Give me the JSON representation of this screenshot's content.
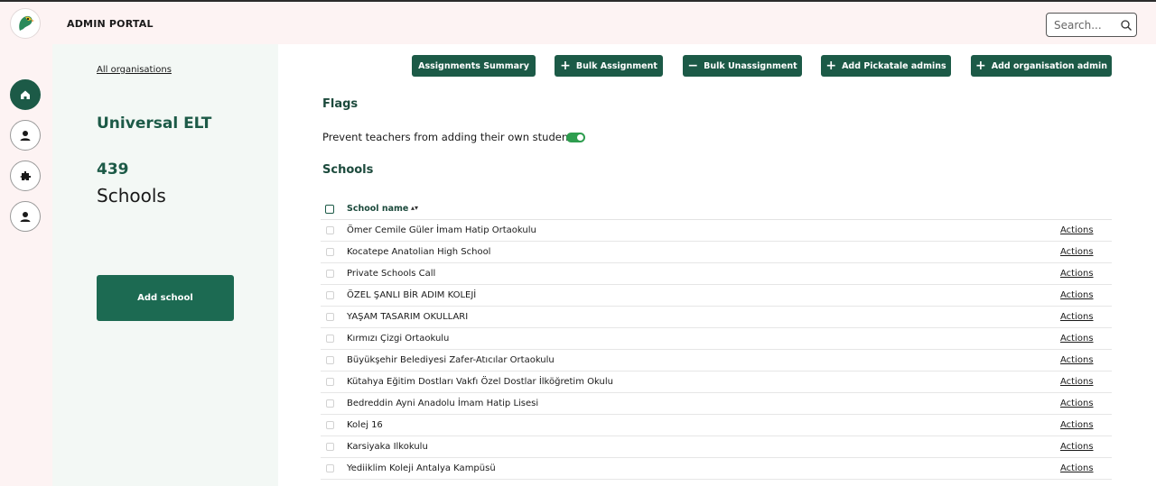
{
  "header": {
    "brand": "ADMIN PORTAL",
    "search_placeholder": "Search..."
  },
  "rail": {
    "items": [
      {
        "icon": "home-icon",
        "active": true
      },
      {
        "icon": "users-icon",
        "active": false
      },
      {
        "icon": "puzzle-icon",
        "active": false
      },
      {
        "icon": "user-icon",
        "active": false
      }
    ]
  },
  "panel": {
    "all_orgs_link": "All organisations",
    "org_name": "Universal ELT",
    "school_count": "439",
    "school_label": "Schools",
    "add_school_label": "Add school"
  },
  "toolbar": {
    "assignments_summary": "Assignments Summary",
    "bulk_assignment": "Bulk Assignment",
    "bulk_unassignment": "Bulk Unassignment",
    "add_pickatale_admins": "Add Pickatale admins",
    "add_org_admin": "Add organisation admin"
  },
  "flags": {
    "heading": "Flags",
    "prevent_teachers_label": "Prevent teachers from adding their own students.",
    "prevent_teachers_enabled": true
  },
  "schools": {
    "heading": "Schools",
    "column_name": "School name",
    "actions_label": "Actions",
    "rows": [
      "Ömer Cemile Güler İmam Hatip Ortaokulu",
      "Kocatepe Anatolian High School",
      "Private Schools Call",
      "ÖZEL ŞANLI BİR ADIM KOLEJİ",
      "YAŞAM TASARIM OKULLARI",
      "Kırmızı Çizgi Ortaokulu",
      "Büyükşehir Belediyesi Zafer-Atıcılar Ortaokulu",
      "Kütahya Eğitim Dostları Vakfı Özel Dostlar İlköğretim Okulu",
      "Bedreddin Ayni Anadolu İmam Hatip Lisesi",
      "Kolej 16",
      "Karsiyaka Ilkokulu",
      "Yediiklim Koleji Antalya Kampüsü"
    ]
  },
  "colors": {
    "primary": "#1c5a47",
    "panel_bg": "#f3f8f5",
    "header_bg": "#fdf3f3",
    "toggle_on": "#2e9d4f"
  }
}
